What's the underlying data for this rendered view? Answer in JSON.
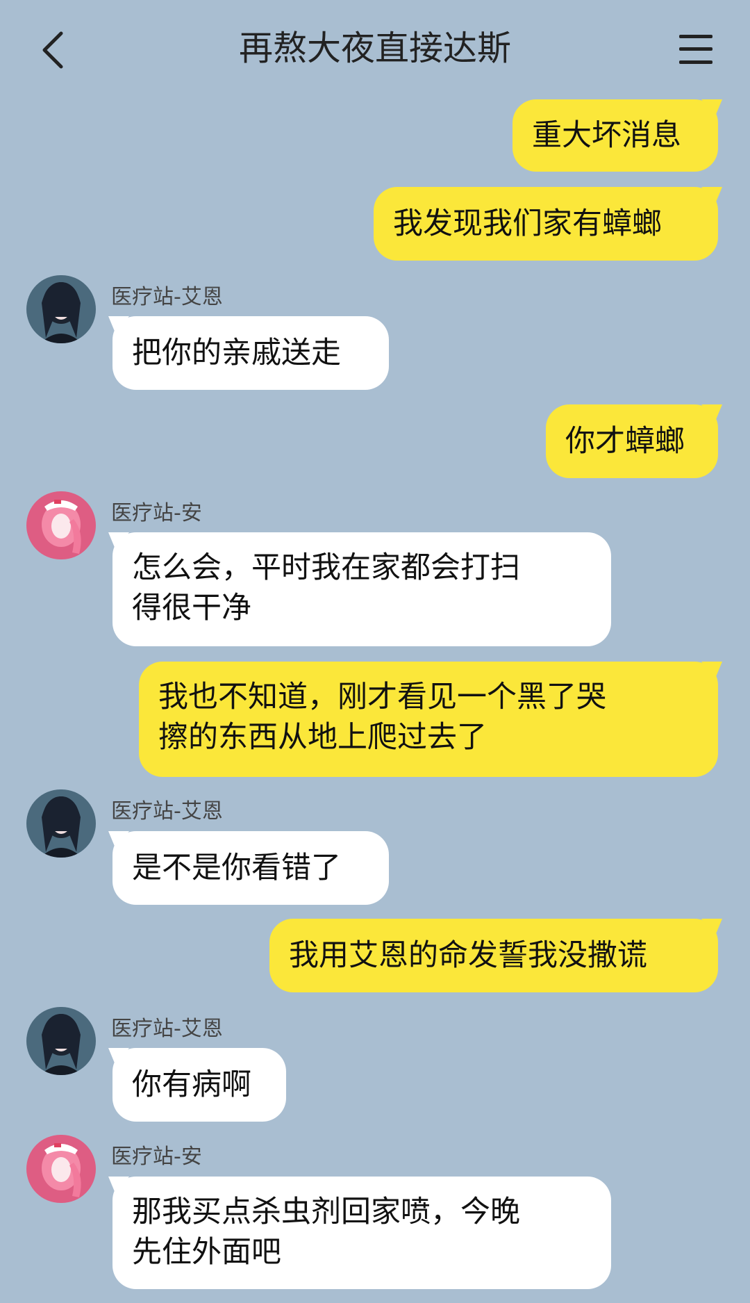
{
  "header": {
    "title": "再熬大夜直接达斯"
  },
  "icons": {
    "back": "chevron-left-icon",
    "menu": "menu-icon"
  },
  "colors": {
    "background": "#a9bed1",
    "outgoing_bubble": "#fbe73a",
    "incoming_bubble": "#ffffff"
  },
  "messages": [
    {
      "direction": "out",
      "text": "重大坏消息"
    },
    {
      "direction": "out",
      "text": "我发现我们家有蟑螂"
    },
    {
      "direction": "in",
      "sender": "医疗站-艾恩",
      "text": "把你的亲戚送走"
    },
    {
      "direction": "out",
      "text": "你才蟑螂"
    },
    {
      "direction": "in",
      "sender": "医疗站-安",
      "text": "怎么会，平时我在家都会打扫\n得很干净"
    },
    {
      "direction": "out",
      "text": "我也不知道，刚才看见一个黑了哭\n擦的东西从地上爬过去了"
    },
    {
      "direction": "in",
      "sender": "医疗站-艾恩",
      "text": "是不是你看错了"
    },
    {
      "direction": "out",
      "text": "我用艾恩的命发誓我没撒谎"
    },
    {
      "direction": "in",
      "sender": "医疗站-艾恩",
      "text": "你有病啊"
    },
    {
      "direction": "in",
      "sender": "医疗站-安",
      "text": "那我买点杀虫剂回家喷，今晚\n先住外面吧"
    }
  ]
}
